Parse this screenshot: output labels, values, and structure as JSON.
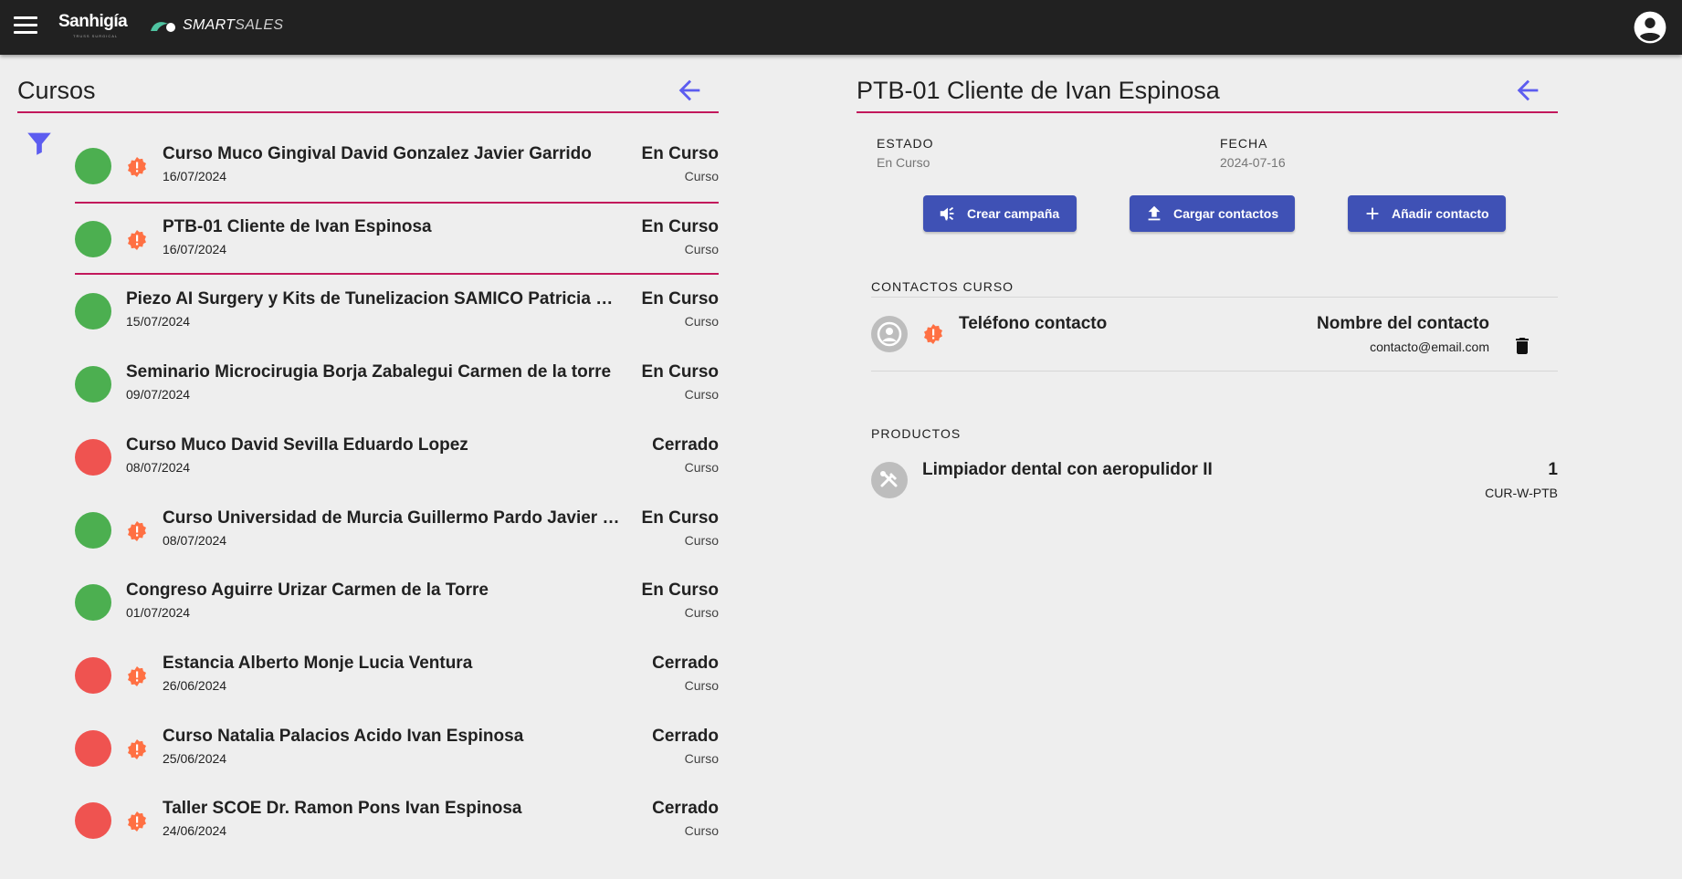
{
  "header": {
    "brand": "Sanhigía",
    "brand_tagline": "TRUSS SURGICAL",
    "app_name_bold": "SMART",
    "app_name_light": "SALES"
  },
  "colors": {
    "topbar": "#212121",
    "accent_underline": "#c2185b",
    "primary_button": "#3f51b5",
    "back_arrow": "#5c5cf0",
    "status_open": "#4caf50",
    "status_closed": "#ef5350",
    "warning": "#ff7043"
  },
  "left": {
    "title": "Cursos",
    "courses": [
      {
        "title": "Curso Muco Gingival David Gonzalez Javier Garrido",
        "date": "16/07/2024",
        "status": "En Curso",
        "type": "Curso",
        "status_color": "green",
        "warning": true
      },
      {
        "title": "PTB-01 Cliente de Ivan Espinosa",
        "date": "16/07/2024",
        "status": "En Curso",
        "type": "Curso",
        "status_color": "green",
        "warning": true,
        "selected": true
      },
      {
        "title": "Piezo AI Surgery y Kits de Tunelizacion SAMICO Patricia de la Torre",
        "date": "15/07/2024",
        "status": "En Curso",
        "type": "Curso",
        "status_color": "green",
        "warning": false
      },
      {
        "title": "Seminario Microcirugia Borja Zabalegui Carmen de la torre",
        "date": "09/07/2024",
        "status": "En Curso",
        "type": "Curso",
        "status_color": "green",
        "warning": false
      },
      {
        "title": "Curso Muco David Sevilla Eduardo Lopez",
        "date": "08/07/2024",
        "status": "Cerrado",
        "type": "Curso",
        "status_color": "red",
        "warning": false
      },
      {
        "title": "Curso Universidad de Murcia Guillermo Pardo Javier Garrido",
        "date": "08/07/2024",
        "status": "En Curso",
        "type": "Curso",
        "status_color": "green",
        "warning": true
      },
      {
        "title": "Congreso Aguirre Urizar Carmen de la Torre",
        "date": "01/07/2024",
        "status": "En Curso",
        "type": "Curso",
        "status_color": "green",
        "warning": false
      },
      {
        "title": "Estancia Alberto Monje Lucia Ventura",
        "date": "26/06/2024",
        "status": "Cerrado",
        "type": "Curso",
        "status_color": "red",
        "warning": true
      },
      {
        "title": "Curso Natalia Palacios Acido Ivan Espinosa",
        "date": "25/06/2024",
        "status": "Cerrado",
        "type": "Curso",
        "status_color": "red",
        "warning": true
      },
      {
        "title": "Taller SCOE Dr. Ramon Pons Ivan Espinosa",
        "date": "24/06/2024",
        "status": "Cerrado",
        "type": "Curso",
        "status_color": "red",
        "warning": true
      }
    ]
  },
  "right": {
    "title": "PTB-01 Cliente de Ivan Espinosa",
    "estado_label": "ESTADO",
    "estado_value": "En Curso",
    "fecha_label": "FECHA",
    "fecha_value": "2024-07-16",
    "buttons": {
      "crear_campana": "Crear campaña",
      "cargar_contactos": "Cargar contactos",
      "anadir_contacto": "Añadir contacto"
    },
    "contactos_label": "CONTACTOS CURSO",
    "contact": {
      "phone": "Teléfono contacto",
      "name": "Nombre del contacto",
      "email": "contacto@email.com"
    },
    "productos_label": "PRODUCTOS",
    "product": {
      "name": "Limpiador dental con aeropulidor II",
      "quantity": "1",
      "code": "CUR-W-PTB"
    }
  }
}
